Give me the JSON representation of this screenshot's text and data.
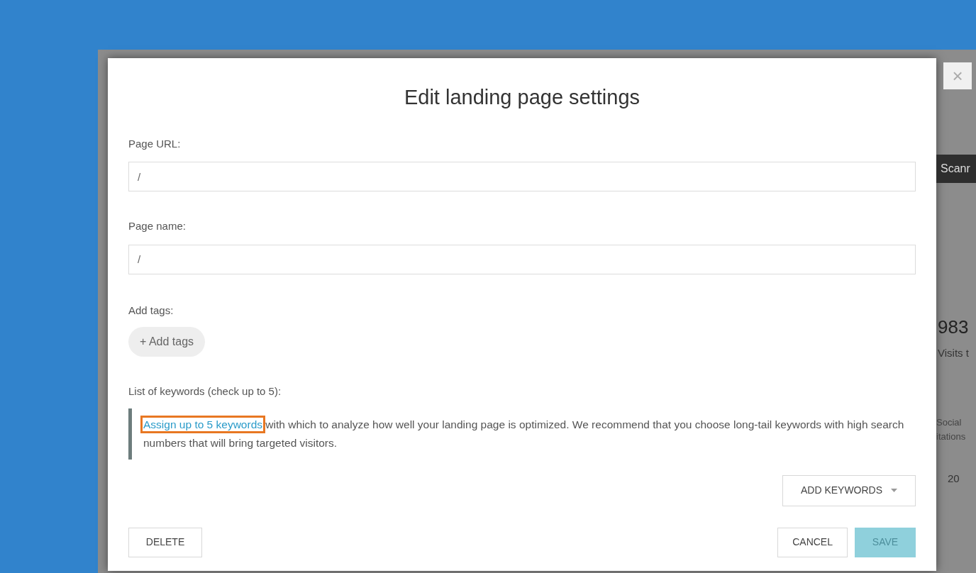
{
  "background_page": {
    "close_symbol": "×",
    "dark_bar_text": "Scanr",
    "stat_value": "983",
    "stat_label": "Visits t",
    "column_heading_lines": [
      "Social",
      "itations"
    ],
    "cell_value": "20"
  },
  "dialog": {
    "title": "Edit landing page settings",
    "fields": [
      {
        "label": "Page URL:",
        "value": "/"
      },
      {
        "label": "Page name:",
        "value": "/"
      }
    ],
    "tags": {
      "label": "Add tags:",
      "button": "+ Add tags"
    },
    "keywords": {
      "label": "List of keywords (check up to 5):",
      "link": "Assign up to 5 keywords",
      "link_highlighted": true,
      "text": "with which to analyze how well your landing page is optimized. We recommend that you choose long-tail keywords with high search numbers that will bring targeted visitors.",
      "dropdown": "ADD KEYWORDS"
    },
    "buttons": [
      {
        "label": "DELETE",
        "kind": "danger",
        "disabled": false
      },
      {
        "label": "CANCEL",
        "kind": "secondary",
        "disabled": false
      },
      {
        "label": "SAVE",
        "kind": "primary",
        "disabled": true
      }
    ]
  }
}
